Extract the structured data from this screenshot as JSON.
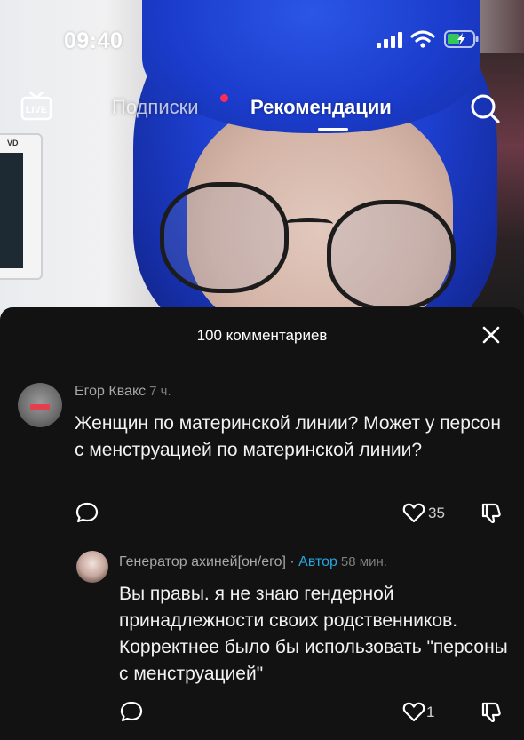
{
  "status_bar": {
    "time": "09:40"
  },
  "top_nav": {
    "live_label": "LIVE",
    "tabs": [
      {
        "label": "Подписки",
        "active": false,
        "has_notification_dot": true
      },
      {
        "label": "Рекомендации",
        "active": true
      }
    ]
  },
  "comments_sheet": {
    "title": "100 комментариев",
    "comments": [
      {
        "author": "Егор Квакс",
        "time": "7 ч.",
        "text": "Женщин по материнской линии? Может у персон с менструацией по материнской линии?",
        "likes": "35"
      }
    ],
    "reply": {
      "author": "Генератор ахиней[он/его]",
      "separator": "·",
      "badge": "Автор",
      "time": "58 мин.",
      "text": "Вы правы. я не знаю гендерной принадлежности своих родственников. Корректнее было бы использовать \"персоны с менструацией\"",
      "likes": "1"
    }
  },
  "colors": {
    "sheet_bg": "#121212",
    "author_badge": "#27a5e0",
    "notification_dot": "#fe2c55",
    "hair_blue": "#1d3fcf"
  },
  "icons": [
    "live-icon",
    "search-icon",
    "close-icon",
    "reply-icon",
    "like-icon",
    "dislike-icon",
    "signal-icon",
    "wifi-icon",
    "battery-icon"
  ]
}
